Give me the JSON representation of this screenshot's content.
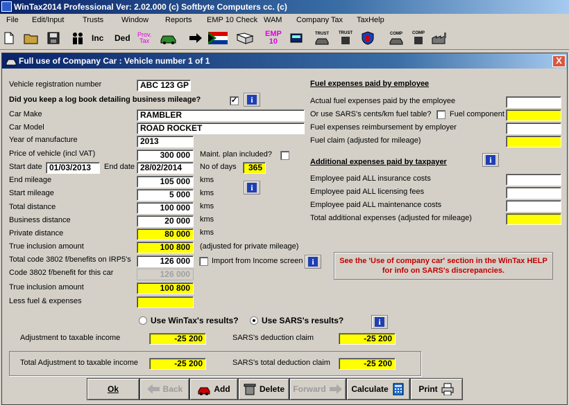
{
  "app": {
    "title": "WinTax2014 Professional Ver: 2.02.000  (c) Softbyte Computers cc. (c)"
  },
  "menu": [
    {
      "label": "File",
      "ul": "F"
    },
    {
      "label": "Edit/Input",
      "ul": "E"
    },
    {
      "label": "Trusts",
      "ul": "T"
    },
    {
      "label": "Window",
      "ul": "W"
    },
    {
      "label": "Reports",
      "ul": "R"
    },
    {
      "label": "EMP 10 Check",
      "ul": "E"
    },
    {
      "label": "WAM",
      "ul": "W"
    },
    {
      "label": "Company Tax",
      "ul": "C"
    },
    {
      "label": "TaxHelp",
      "ul": "x"
    }
  ],
  "toolbar": {
    "inc": "Inc",
    "ded": "Ded",
    "prov": "Prov.",
    "tax": "Tax",
    "emp": "EMP",
    "ten": "10",
    "trust1": "TRUST",
    "trust2": "TRUST",
    "comp1": "COMP",
    "comp2": "COMP"
  },
  "dialog": {
    "title": "Full use of Company Car :  Vehicle number 1 of 1",
    "close": "X",
    "reg_label": "Vehicle registration number",
    "reg_value": "ABC 123 GP",
    "logbook_label": "Did you keep a log book detailing business mileage?",
    "logbook_checked": "✓",
    "make_label": "Car Make",
    "make_value": "RAMBLER",
    "model_label": "Car Model",
    "model_value": "ROAD ROCKET",
    "year_label": "Year of manufacture",
    "year_value": "2013",
    "price_label": "Price of vehicle (incl VAT)",
    "price_value": "300 000",
    "maint_label": "Maint. plan included?",
    "start_label": "Start date",
    "start_value": "01/03/2013",
    "end_label": "End date",
    "end_value": "28/02/2014",
    "days_label": "No of days",
    "days_value": "365",
    "endmil_label": "End mileage",
    "endmil_value": "105 000",
    "startmil_label": "Start mileage",
    "startmil_value": "5 000",
    "total_label": "Total distance",
    "total_value": "100 000",
    "business_label": "Business distance",
    "business_value": "20 000",
    "private_label": "Private distance",
    "private_value": "80 000",
    "kms": "kms",
    "trueinc_label": "True inclusion amount",
    "trueinc_value": "100 800",
    "trueinc_note": "(adjusted for private mileage)",
    "code3802_label": "Total code 3802 f/benefits on IRP5's",
    "code3802_value": "126 000",
    "import_label": "Import from Income screen",
    "code3802car_label": "Code 3802 f/benefit for this car",
    "code3802car_value": "126 000",
    "trueinc2_label": "True inclusion amount",
    "trueinc2_value": "100 800",
    "lessfuel_label": "Less fuel & expenses",
    "lessfuel_value": "",
    "fuel_heading": "Fuel expenses paid by employee",
    "actual_fuel_label": "Actual fuel expenses paid by the employee",
    "sars_table_label": "Or use SARS's cents/km fuel table?",
    "fuel_component_label": "Fuel component",
    "fuel_reimb_label": "Fuel expenses reimbursement by employer",
    "fuel_claim_label": "Fuel claim (adjusted for mileage)",
    "additional_heading": "Additional expenses paid by taxpayer",
    "ins_label": "Employee paid ALL insurance costs",
    "lic_label": "Employee paid ALL licensing fees",
    "maint_costs_label": "Employee paid ALL maintenance costs",
    "total_add_label": "Total additional expenses (adjusted for mileage)",
    "note": "See the 'Use of company car' section in the WinTax HELP for info on SARS's discrepancies.",
    "wintax_results": "Use WinTax's results?",
    "sars_results": "Use SARS's results?",
    "adj_label": "Adjustment to taxable income",
    "adj_value": "-25 200",
    "sars_ded_label": "SARS's deduction claim",
    "sars_ded_value": "-25 200",
    "tot_adj_label": "Total Adjustment to taxable income",
    "tot_adj_value": "-25 200",
    "sars_tot_label": "SARS's total deduction claim",
    "sars_tot_value": "-25 200"
  },
  "buttons": {
    "ok": "Ok",
    "back": "Back",
    "add": "Add",
    "delete": "Delete",
    "forward": "Forward",
    "calculate": "Calculate",
    "print": "Print"
  }
}
